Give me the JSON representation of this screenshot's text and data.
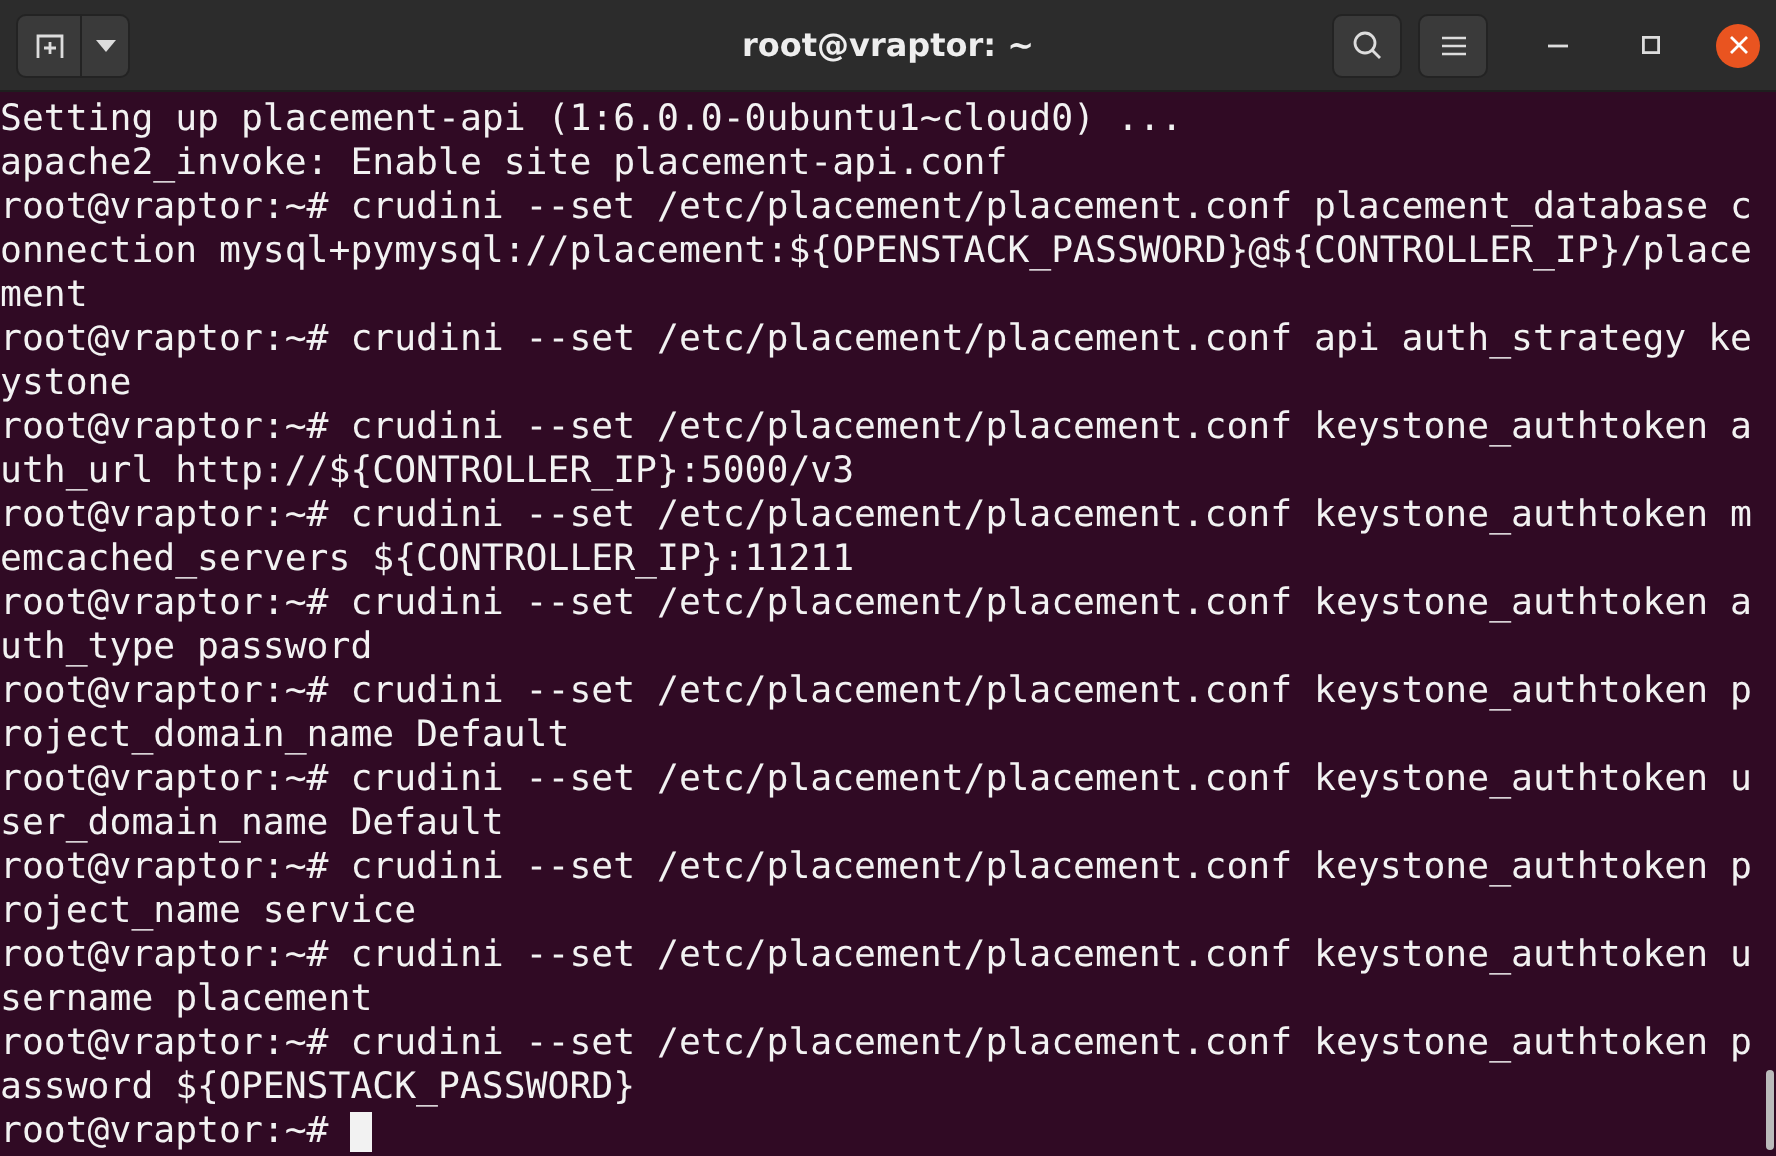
{
  "window": {
    "title": "root@vraptor: ~"
  },
  "terminal": {
    "lines": [
      "Setting up placement-api (1:6.0.0-0ubuntu1~cloud0) ...",
      "apache2_invoke: Enable site placement-api.conf",
      "root@vraptor:~# crudini --set /etc/placement/placement.conf placement_database c",
      "onnection mysql+pymysql://placement:${OPENSTACK_PASSWORD}@${CONTROLLER_IP}/place",
      "ment",
      "root@vraptor:~# crudini --set /etc/placement/placement.conf api auth_strategy ke",
      "ystone",
      "root@vraptor:~# crudini --set /etc/placement/placement.conf keystone_authtoken a",
      "uth_url http://${CONTROLLER_IP}:5000/v3",
      "root@vraptor:~# crudini --set /etc/placement/placement.conf keystone_authtoken m",
      "emcached_servers ${CONTROLLER_IP}:11211",
      "root@vraptor:~# crudini --set /etc/placement/placement.conf keystone_authtoken a",
      "uth_type password",
      "root@vraptor:~# crudini --set /etc/placement/placement.conf keystone_authtoken p",
      "roject_domain_name Default",
      "root@vraptor:~# crudini --set /etc/placement/placement.conf keystone_authtoken u",
      "ser_domain_name Default",
      "root@vraptor:~# crudini --set /etc/placement/placement.conf keystone_authtoken p",
      "roject_name service",
      "root@vraptor:~# crudini --set /etc/placement/placement.conf keystone_authtoken u",
      "sername placement",
      "root@vraptor:~# crudini --set /etc/placement/placement.conf keystone_authtoken p",
      "assword ${OPENSTACK_PASSWORD}"
    ],
    "prompt": "root@vraptor:~#"
  }
}
